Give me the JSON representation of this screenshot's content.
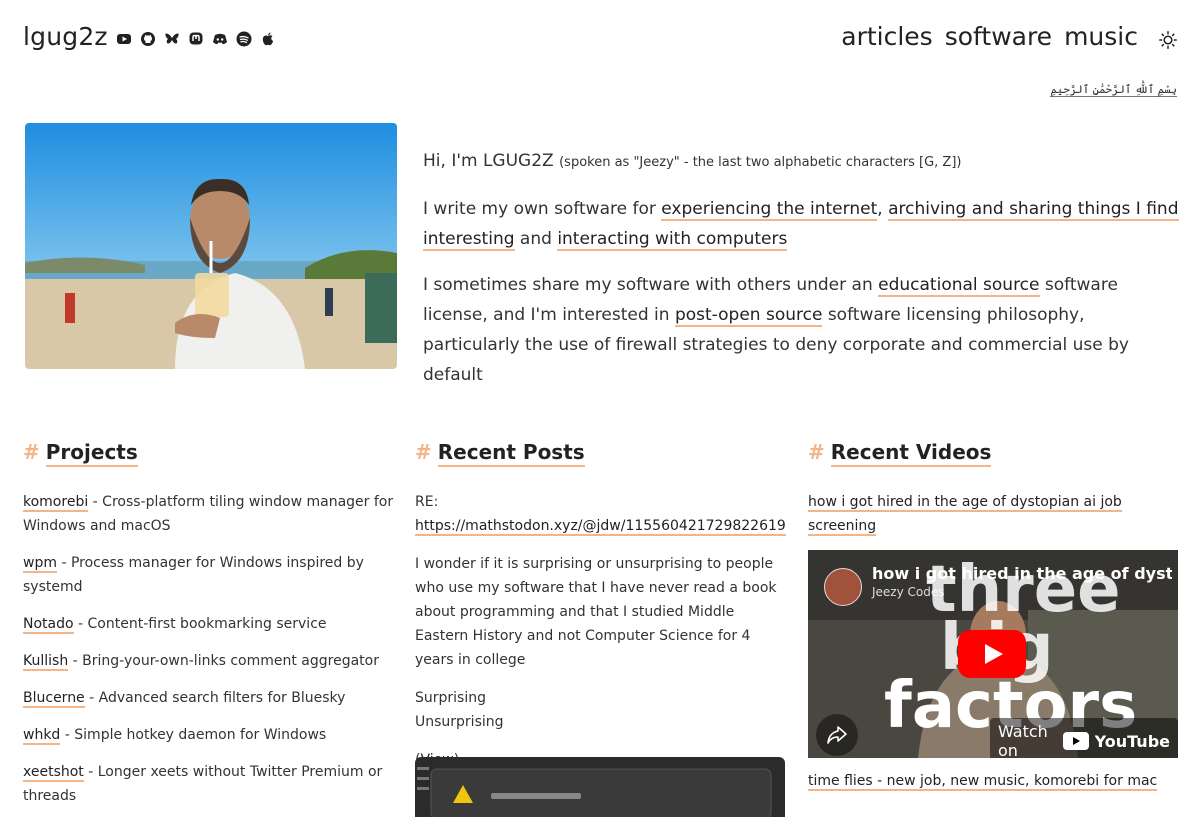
{
  "header": {
    "brand": "lgug2z",
    "nav": [
      "articles",
      "software",
      "music"
    ],
    "social_icons": [
      "youtube-icon",
      "github-icon",
      "bluesky-icon",
      "mastodon-icon",
      "discord-icon",
      "spotify-icon",
      "apple-icon"
    ]
  },
  "bismillah": "بِسْمِ ٱللَّٰهِ ٱلرَّحْمَٰنِ ٱلرَّحِيمِ",
  "intro": {
    "hi": "Hi, I'm LGUG2Z",
    "spoken": "(spoken as \"Jeezy\" - the last two alphabetic characters [G, Z])",
    "p2_pre": "I write my own software for",
    "p2_link1": "experiencing the internet",
    "p2_comma": ",",
    "p2_link2": "archiving and sharing things I find interesting",
    "p2_and": "and",
    "p2_link3": "interacting with computers",
    "p3_pre": "I sometimes share my software with others under an",
    "p3_link1": "educational source",
    "p3_mid": "software license, and I'm interested in",
    "p3_link2": "post-open source",
    "p3_post": "software licensing philosophy, particularly the use of firewall strategies to deny corporate and commercial use by default"
  },
  "projects": {
    "title": "Projects",
    "items": [
      {
        "name": "komorebi",
        "desc": "- Cross-platform tiling window manager for Windows and macOS"
      },
      {
        "name": "wpm",
        "desc": "- Process manager for Windows inspired by systemd"
      },
      {
        "name": "Notado",
        "desc": "- Content-first bookmarking service"
      },
      {
        "name": "Kullish",
        "desc": "- Bring-your-own-links comment aggregator"
      },
      {
        "name": "Blucerne",
        "desc": "- Advanced search filters for Bluesky"
      },
      {
        "name": "whkd",
        "desc": "- Simple hotkey daemon for Windows"
      },
      {
        "name": "xeetshot",
        "desc": "- Longer xeets without Twitter Premium or threads"
      }
    ]
  },
  "posts": {
    "title": "Recent Posts",
    "re_label": "RE:",
    "re_link": "https://mathstodon.xyz/@jdw/115560421729822619",
    "body": "I wonder if it is surprising or unsurprising to people who use my software that I have never read a book about programming and that I studied Middle Eastern History and not Computer Science for 4 years in college",
    "option1": "Surprising",
    "option2": "Unsurprising",
    "view_open": "(",
    "view_label": "View",
    "view_close": ")"
  },
  "videos": {
    "title": "Recent Videos",
    "video1": "how i got hired in the age of dystopian ai job screening",
    "thumb_title": "how i got hired in the age of dystopia",
    "channel": "Jeezy Codes",
    "big_text": [
      "three",
      "big",
      "factors"
    ],
    "watch_on": "Watch on",
    "youtube": "YouTube",
    "video2": "time flies - new job, new music, komorebi for mac"
  },
  "colors": {
    "accent": "#f3b486",
    "text": "#222222",
    "youtube_red": "#ff0000"
  }
}
